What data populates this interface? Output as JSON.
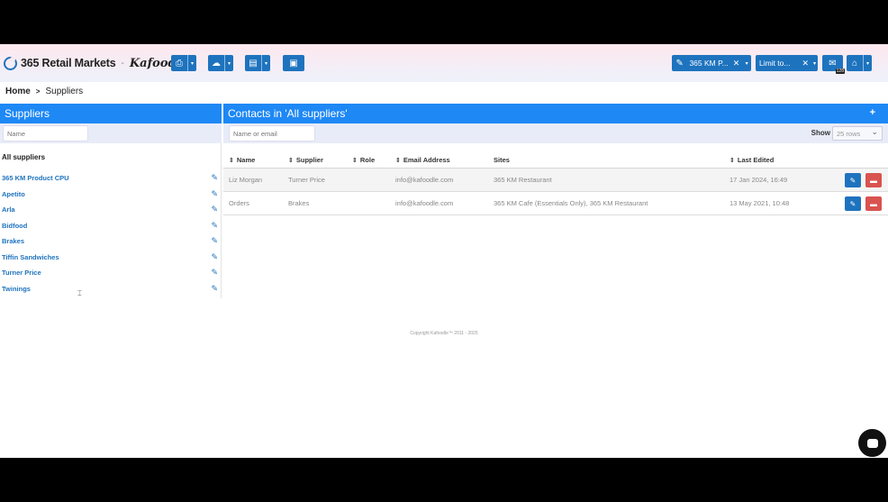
{
  "brand": {
    "name": "365 Retail Markets",
    "separator": "-",
    "kafoodle": "Kafoodlé"
  },
  "nav": {
    "icons": [
      "print-icon",
      "cloud-icon",
      "file-icon",
      "qr-icon"
    ],
    "location_chip": "365 KM P...",
    "limit_chip": "Limit to...",
    "mail_badge": "128"
  },
  "breadcrumb": {
    "home": "Home",
    "separator": ">",
    "current": "Suppliers"
  },
  "left_panel": {
    "title": "Suppliers",
    "filter_placeholder": "Name",
    "all_label": "All suppliers",
    "suppliers": [
      "365 KM Product CPU",
      "Apetito",
      "Arla",
      "Bidfood",
      "Brakes",
      "Tiffin Sandwiches",
      "Turner Price",
      "Twinings"
    ]
  },
  "right_panel": {
    "title": "Contacts in 'All suppliers'",
    "add_icon": "+",
    "filter_placeholder": "Name or email",
    "show_label": "Show",
    "rows_option": "25 rows"
  },
  "table": {
    "columns": [
      "Name",
      "Supplier",
      "Role",
      "Email Address",
      "Sites",
      "Last Edited"
    ],
    "rows": [
      {
        "name": "Liz Morgan",
        "supplier": "Turner Price",
        "role": "",
        "email": "info@kafoodle.com",
        "sites": "365 KM Restaurant",
        "last_edited": "17 Jan 2024, 16:49"
      },
      {
        "name": "Orders",
        "supplier": "Brakes",
        "role": "",
        "email": "info@kafoodle.com",
        "sites": "365 KM Cafe (Essentials Only), 365 KM Restaurant",
        "last_edited": "13 May 2021, 10:48"
      }
    ]
  },
  "footer": {
    "copyright": "Copyright Kafoodle™ 2011 - 2025"
  },
  "colors": {
    "primary": "#1e73be",
    "header_blue": "#1e88f5",
    "danger": "#d9534f"
  }
}
